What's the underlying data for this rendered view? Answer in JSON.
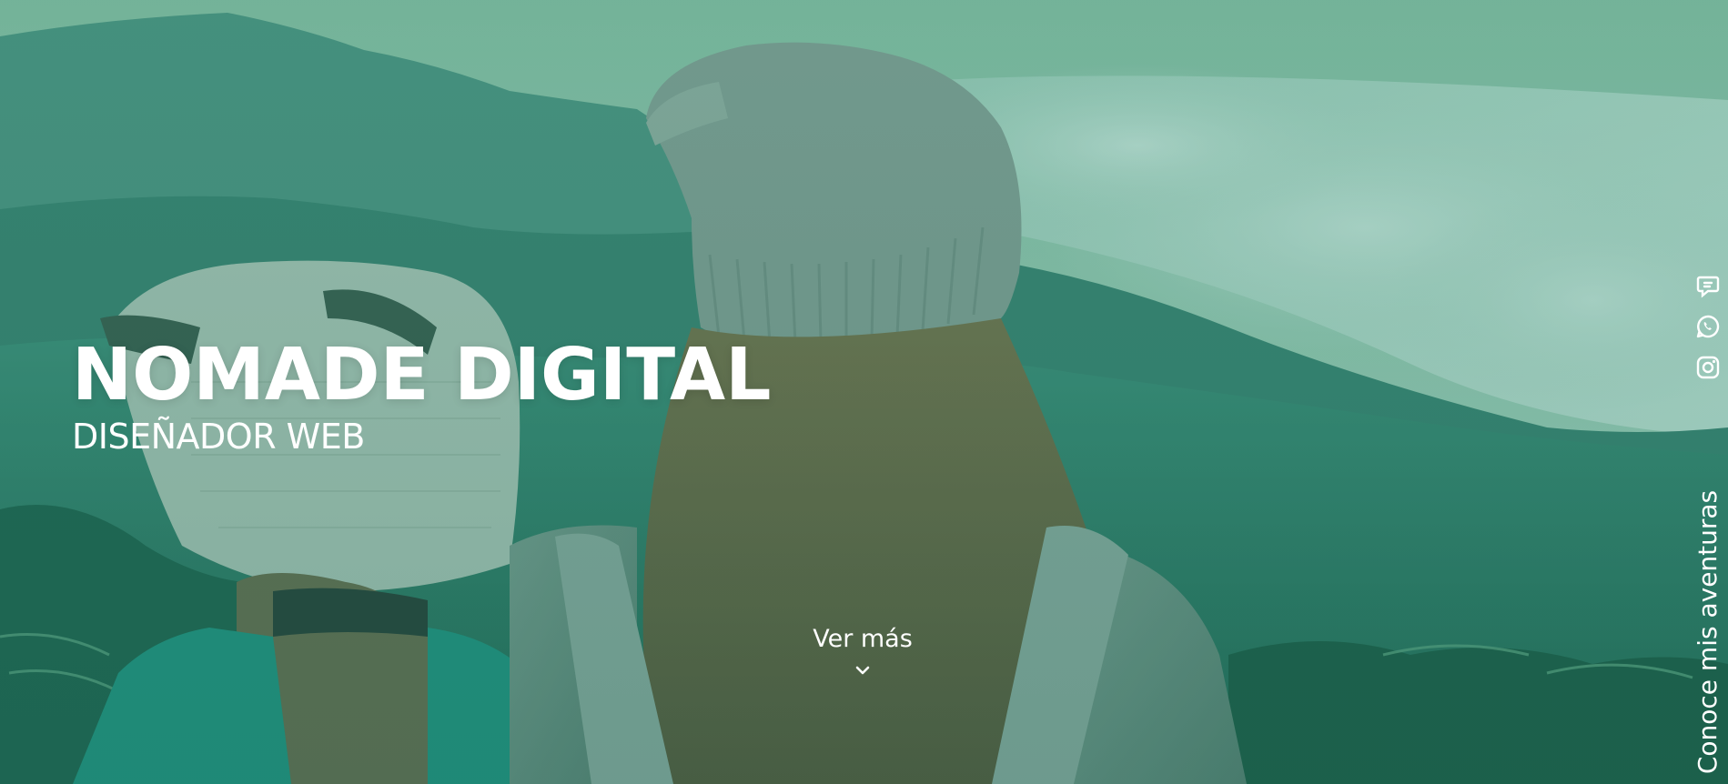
{
  "hero": {
    "title": "NOMADE DIGITAL",
    "subtitle": "DISEÑADOR WEB",
    "cta_label": "Ver más",
    "cta_icon": "chevron-down-icon",
    "overlay_color": "#2f8f73"
  },
  "social": {
    "caption": "Conoce mis aventuras",
    "icons": [
      "chat-icon",
      "whatsapp-icon",
      "instagram-icon"
    ]
  },
  "colors": {
    "text": "#ffffff",
    "sky": "#9fc9b3",
    "mountains": "#2f7868",
    "foreground": "#1f5d4c"
  }
}
